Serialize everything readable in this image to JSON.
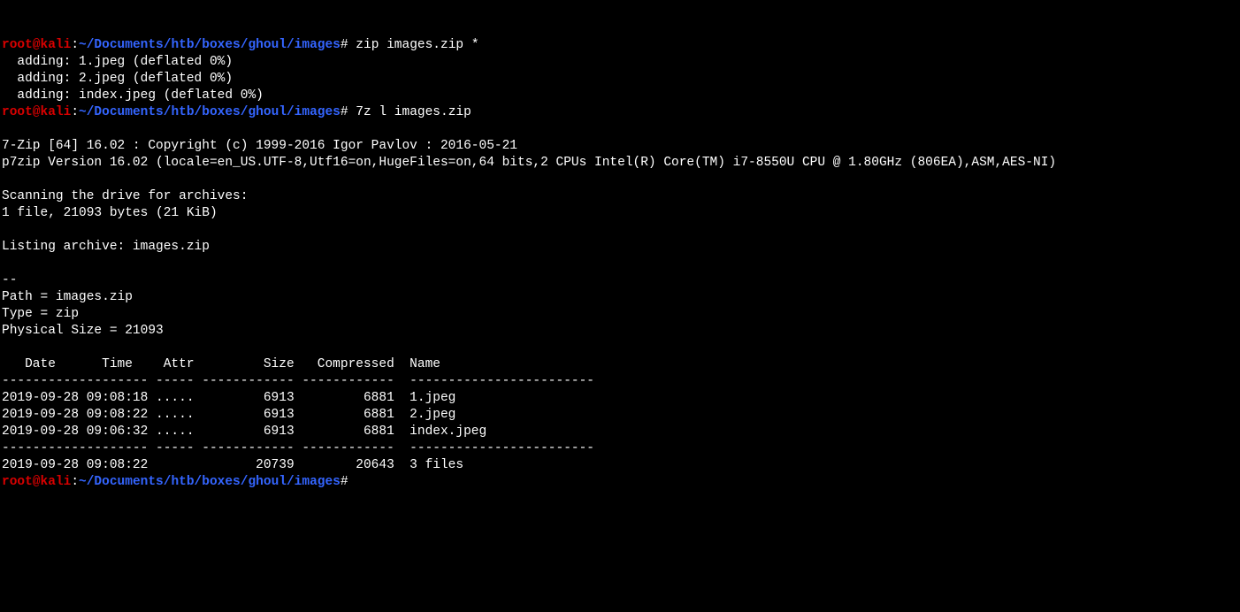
{
  "lines": {
    "0": ""
  },
  "prompts": [
    {
      "user": "root@kali",
      "colon": ":",
      "path": "~/Documents/htb/boxes/ghoul/images",
      "hash": "# ",
      "cmd": "zip images.zip *"
    },
    {
      "user": "root@kali",
      "colon": ":",
      "path": "~/Documents/htb/boxes/ghoul/images",
      "hash": "# ",
      "cmd": "7z l images.zip"
    },
    {
      "user": "root@kali",
      "colon": ":",
      "path": "~/Documents/htb/boxes/ghoul/images",
      "hash": "# ",
      "cmd": ""
    }
  ],
  "output": {
    "zip": [
      "  adding: 1.jpeg (deflated 0%)",
      "  adding: 2.jpeg (deflated 0%)",
      "  adding: index.jpeg (deflated 0%)"
    ],
    "sevenzip": [
      "7-Zip [64] 16.02 : Copyright (c) 1999-2016 Igor Pavlov : 2016-05-21",
      "p7zip Version 16.02 (locale=en_US.UTF-8,Utf16=on,HugeFiles=on,64 bits,2 CPUs Intel(R) Core(TM) i7-8550U CPU @ 1.80GHz (806EA),ASM,AES-NI)",
      "Scanning the drive for archives:",
      "1 file, 21093 bytes (21 KiB)",
      "Listing archive: images.zip",
      "--",
      "Path = images.zip",
      "Type = zip",
      "Physical Size = 21093"
    ],
    "table": {
      "header": "   Date      Time    Attr         Size   Compressed  Name",
      "div": "------------------- ----- ------------ ------------  ------------------------",
      "rows": [
        "2019-09-28 09:08:18 .....         6913         6881  1.jpeg",
        "2019-09-28 09:08:22 .....         6913         6881  2.jpeg",
        "2019-09-28 09:06:32 .....         6913         6881  index.jpeg"
      ],
      "summary": "2019-09-28 09:08:22              20739        20643  3 files"
    }
  }
}
